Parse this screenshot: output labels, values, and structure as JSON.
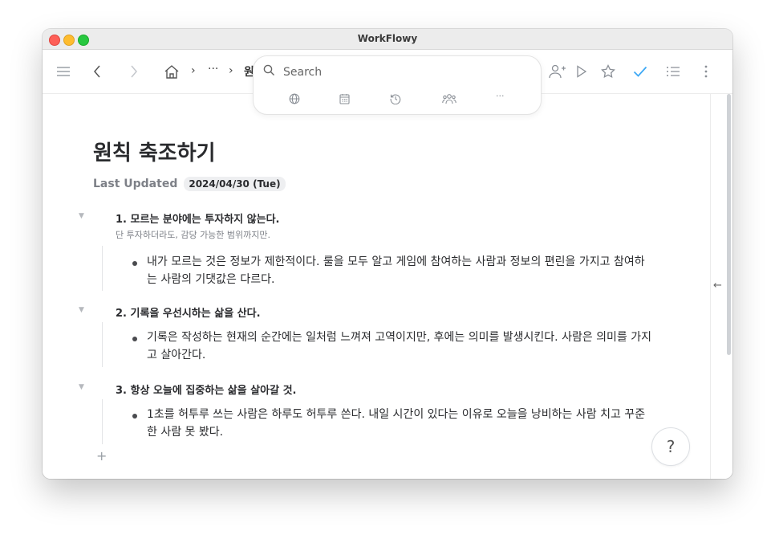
{
  "window": {
    "title": "WorkFlowy"
  },
  "breadcrumb": {
    "ellipsis": "···",
    "current": "원"
  },
  "search": {
    "placeholder": "Search"
  },
  "filters": [
    "globe-icon",
    "calendar-icon",
    "history-icon",
    "people-icon",
    "more-dots-icon"
  ],
  "filter_more": "···",
  "toolbar_right": [
    "add-user-icon",
    "play-icon",
    "star-icon",
    "check-icon",
    "list-icon",
    "kebab-icon"
  ],
  "accent_check_color": "#3da8f5",
  "document": {
    "title": "원칙 축조하기",
    "last_updated_label": "Last Updated",
    "last_updated_date": "2024/04/30 (Tue)"
  },
  "sections": [
    {
      "title": "1. 모르는 분야에는 투자하지 않는다.",
      "note": "단 투자하더라도, 감당 가능한 범위까지만.",
      "bullets": [
        "내가 모르는 것은 정보가 제한적이다. 룰을 모두 알고 게임에 참여하는 사람과 정보의 편린을 가지고 참여하는 사람의 기댓값은 다르다."
      ]
    },
    {
      "title": "2. 기록을 우선시하는 삶을 산다.",
      "note": "",
      "bullets": [
        "기록은 작성하는 현재의 순간에는 일처럼 느껴져 고역이지만, 후에는 의미를 발생시킨다. 사람은 의미를 가지고 살아간다."
      ]
    },
    {
      "title": "3. 항상 오늘에 집중하는 삶을 살아갈 것.",
      "note": "",
      "bullets": [
        "1초를 허투루 쓰는 사람은 하루도 허투루 쓴다. 내일 시간이 있다는 이유로 오늘을 낭비하는 사람 치고 꾸준한 사람 못 봤다."
      ]
    }
  ],
  "add_label": "+",
  "help_label": "?",
  "collapse_glyph": "▼",
  "back_glyph": "←"
}
